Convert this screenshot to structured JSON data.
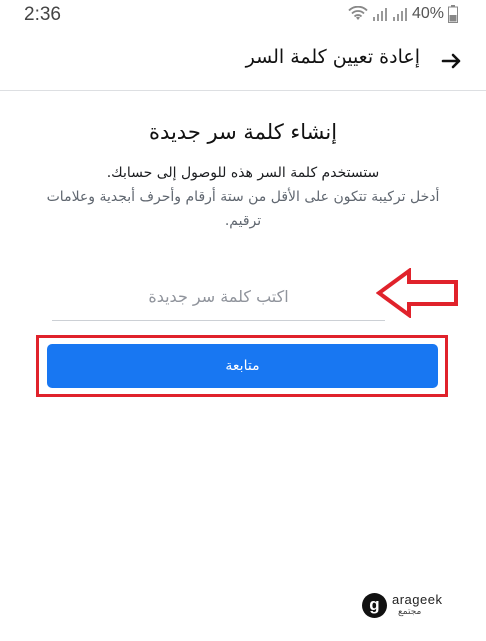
{
  "status_bar": {
    "time": "2:36",
    "battery_text": "40%",
    "icons": [
      "wifi-icon",
      "signal-icon",
      "signal-icon",
      "battery-icon"
    ]
  },
  "app_bar": {
    "title": "إعادة تعيين كلمة السر",
    "back_icon": "arrow-right-icon"
  },
  "main": {
    "heading": "إنشاء كلمة سر جديدة",
    "description_line1": "ستستخدم كلمة السر هذه للوصول إلى حسابك.",
    "description_line2": "أدخل تركيبة تتكون على الأقل من ستة أرقام وأحرف أبجدية وعلامات ترقيم.",
    "password_placeholder": "اكتب كلمة سر جديدة",
    "password_value": "",
    "continue_label": "متابعة"
  },
  "annotations": {
    "arrow_color": "#e0222b",
    "highlight_color": "#e0222b"
  },
  "watermark": {
    "logo_letter": "g",
    "text": "arageek",
    "text_ar": "مجتمع"
  },
  "colors": {
    "primary": "#1877f2",
    "annotation": "#e0222b"
  }
}
